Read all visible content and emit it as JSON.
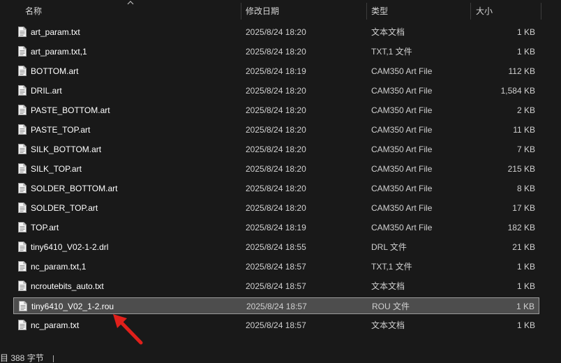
{
  "header": {
    "name": "名称",
    "date": "修改日期",
    "type": "类型",
    "size": "大小"
  },
  "files": [
    {
      "name": "art_param.txt",
      "date": "2025/8/24 18:20",
      "type": "文本文档",
      "size": "1 KB"
    },
    {
      "name": "art_param.txt,1",
      "date": "2025/8/24 18:20",
      "type": "TXT,1 文件",
      "size": "1 KB"
    },
    {
      "name": "BOTTOM.art",
      "date": "2025/8/24 18:19",
      "type": "CAM350 Art File",
      "size": "112 KB"
    },
    {
      "name": "DRIL.art",
      "date": "2025/8/24 18:20",
      "type": "CAM350 Art File",
      "size": "1,584 KB"
    },
    {
      "name": "PASTE_BOTTOM.art",
      "date": "2025/8/24 18:20",
      "type": "CAM350 Art File",
      "size": "2 KB"
    },
    {
      "name": "PASTE_TOP.art",
      "date": "2025/8/24 18:20",
      "type": "CAM350 Art File",
      "size": "11 KB"
    },
    {
      "name": "SILK_BOTTOM.art",
      "date": "2025/8/24 18:20",
      "type": "CAM350 Art File",
      "size": "7 KB"
    },
    {
      "name": "SILK_TOP.art",
      "date": "2025/8/24 18:20",
      "type": "CAM350 Art File",
      "size": "215 KB"
    },
    {
      "name": "SOLDER_BOTTOM.art",
      "date": "2025/8/24 18:20",
      "type": "CAM350 Art File",
      "size": "8 KB"
    },
    {
      "name": "SOLDER_TOP.art",
      "date": "2025/8/24 18:20",
      "type": "CAM350 Art File",
      "size": "17 KB"
    },
    {
      "name": "TOP.art",
      "date": "2025/8/24 18:19",
      "type": "CAM350 Art File",
      "size": "182 KB"
    },
    {
      "name": "tiny6410_V02-1-2.drl",
      "date": "2025/8/24 18:55",
      "type": "DRL 文件",
      "size": "21 KB"
    },
    {
      "name": "nc_param.txt,1",
      "date": "2025/8/24 18:57",
      "type": "TXT,1 文件",
      "size": "1 KB"
    },
    {
      "name": "ncroutebits_auto.txt",
      "date": "2025/8/24 18:57",
      "type": "文本文档",
      "size": "1 KB"
    },
    {
      "name": "tiny6410_V02_1-2.rou",
      "date": "2025/8/24 18:57",
      "type": "ROU 文件",
      "size": "1 KB",
      "selected": true
    },
    {
      "name": "nc_param.txt",
      "date": "2025/8/24 18:57",
      "type": "文本文档",
      "size": "1 KB"
    }
  ],
  "status": {
    "text": "目 388 字节"
  },
  "colors": {
    "background": "#191919",
    "selected_row": "#4d4d4d",
    "arrow": "#e0201b"
  },
  "icons": {
    "file": "document-icon",
    "sort": "chevron-up-icon",
    "annotation": "red-arrow-icon"
  }
}
